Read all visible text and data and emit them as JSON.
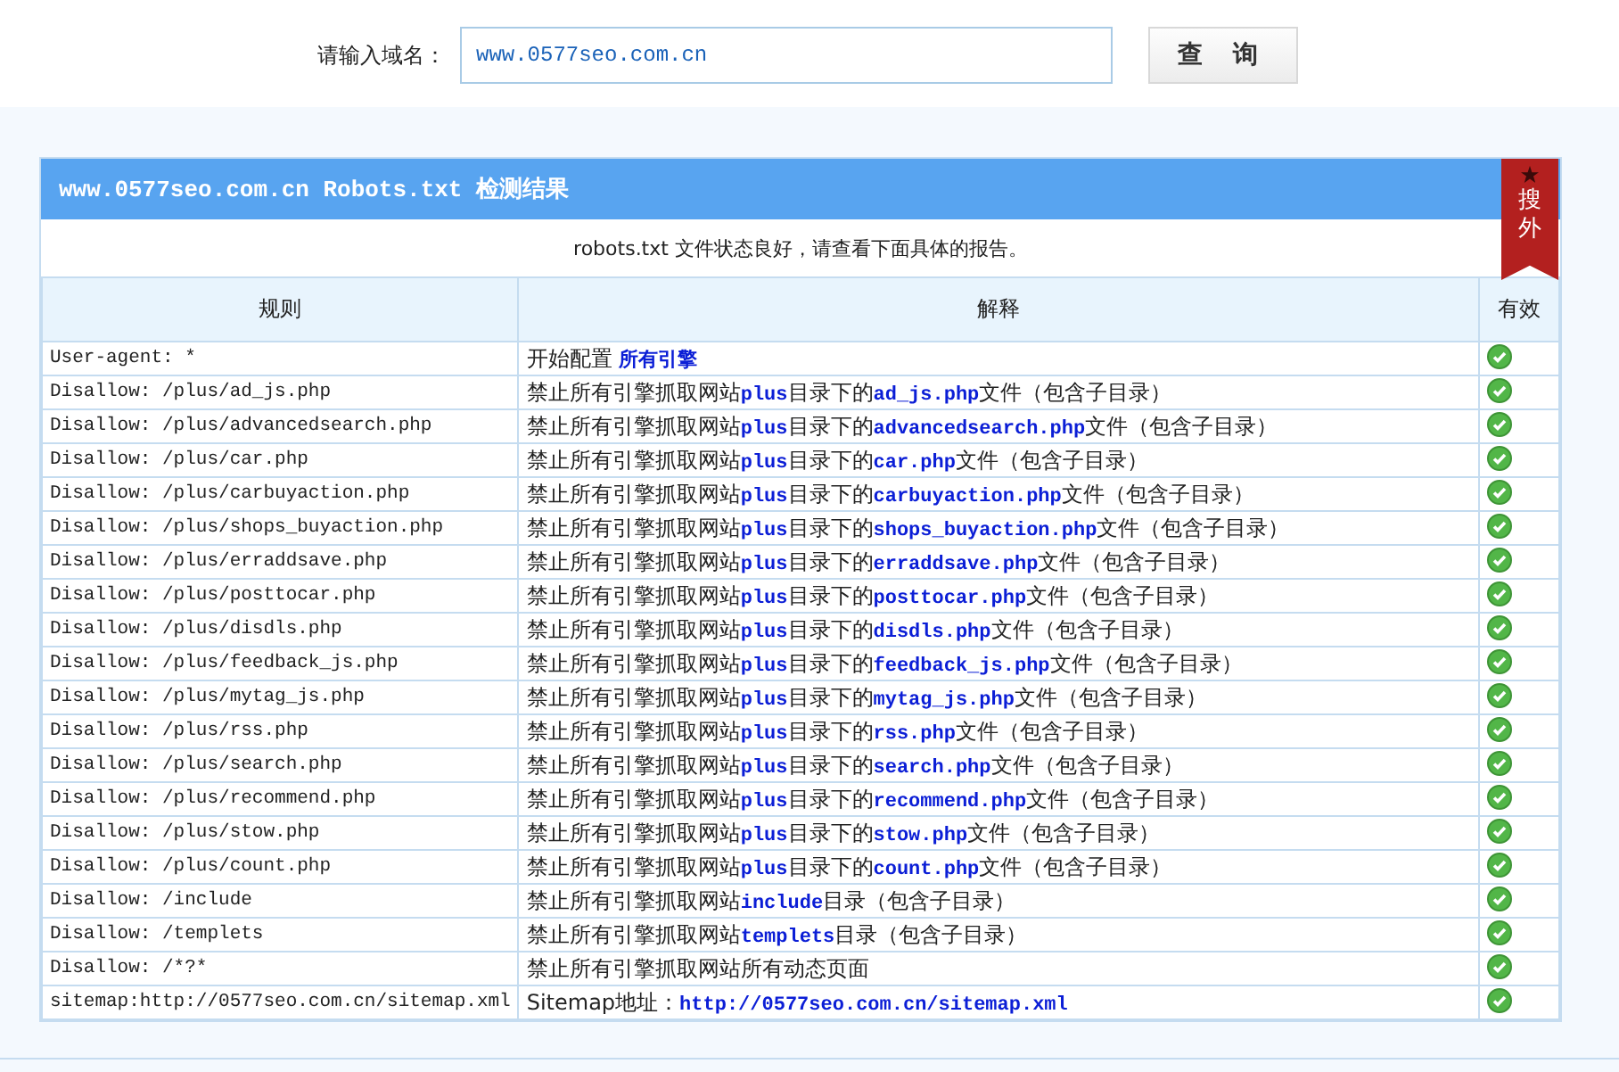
{
  "search": {
    "label": "请输入域名：",
    "value": "www.0577seo.com.cn",
    "button": "查 询"
  },
  "result": {
    "title": "www.0577seo.com.cn Robots.txt 检测结果",
    "ribbon": "搜外",
    "summary": "robots.txt 文件状态良好，请查看下面具体的报告。"
  },
  "table": {
    "columns": [
      "规则",
      "解释",
      "有效"
    ],
    "rows": [
      {
        "rule": "User-agent: *",
        "explanation": "开始配置 **所有引擎**",
        "valid": true
      },
      {
        "rule": "Disallow: /plus/ad_js.php",
        "explanation": "禁止所有引擎抓取网站**plus**目录下的**ad_js.php**文件（包含子目录）",
        "valid": true
      },
      {
        "rule": "Disallow: /plus/advancedsearch.php",
        "explanation": "禁止所有引擎抓取网站**plus**目录下的**advancedsearch.php**文件（包含子目录）",
        "valid": true
      },
      {
        "rule": "Disallow: /plus/car.php",
        "explanation": "禁止所有引擎抓取网站**plus**目录下的**car.php**文件（包含子目录）",
        "valid": true
      },
      {
        "rule": "Disallow: /plus/carbuyaction.php",
        "explanation": "禁止所有引擎抓取网站**plus**目录下的**carbuyaction.php**文件（包含子目录）",
        "valid": true
      },
      {
        "rule": "Disallow: /plus/shops_buyaction.php",
        "explanation": "禁止所有引擎抓取网站**plus**目录下的**shops_buyaction.php**文件（包含子目录）",
        "valid": true
      },
      {
        "rule": "Disallow: /plus/erraddsave.php",
        "explanation": "禁止所有引擎抓取网站**plus**目录下的**erraddsave.php**文件（包含子目录）",
        "valid": true
      },
      {
        "rule": "Disallow: /plus/posttocar.php",
        "explanation": "禁止所有引擎抓取网站**plus**目录下的**posttocar.php**文件（包含子目录）",
        "valid": true
      },
      {
        "rule": "Disallow: /plus/disdls.php",
        "explanation": "禁止所有引擎抓取网站**plus**目录下的**disdls.php**文件（包含子目录）",
        "valid": true
      },
      {
        "rule": "Disallow: /plus/feedback_js.php",
        "explanation": "禁止所有引擎抓取网站**plus**目录下的**feedback_js.php**文件（包含子目录）",
        "valid": true
      },
      {
        "rule": "Disallow: /plus/mytag_js.php",
        "explanation": "禁止所有引擎抓取网站**plus**目录下的**mytag_js.php**文件（包含子目录）",
        "valid": true
      },
      {
        "rule": "Disallow: /plus/rss.php",
        "explanation": "禁止所有引擎抓取网站**plus**目录下的**rss.php**文件（包含子目录）",
        "valid": true
      },
      {
        "rule": "Disallow: /plus/search.php",
        "explanation": "禁止所有引擎抓取网站**plus**目录下的**search.php**文件（包含子目录）",
        "valid": true
      },
      {
        "rule": "Disallow: /plus/recommend.php",
        "explanation": "禁止所有引擎抓取网站**plus**目录下的**recommend.php**文件（包含子目录）",
        "valid": true
      },
      {
        "rule": "Disallow: /plus/stow.php",
        "explanation": "禁止所有引擎抓取网站**plus**目录下的**stow.php**文件（包含子目录）",
        "valid": true
      },
      {
        "rule": "Disallow: /plus/count.php",
        "explanation": "禁止所有引擎抓取网站**plus**目录下的**count.php**文件（包含子目录）",
        "valid": true
      },
      {
        "rule": "Disallow: /include",
        "explanation": "禁止所有引擎抓取网站**include**目录（包含子目录）",
        "valid": true
      },
      {
        "rule": "Disallow: /templets",
        "explanation": "禁止所有引擎抓取网站**templets**目录（包含子目录）",
        "valid": true
      },
      {
        "rule": "Disallow: /*?*",
        "explanation": "禁止所有引擎抓取网站所有动态页面",
        "valid": true
      },
      {
        "rule": "sitemap:http://0577seo.com.cn/sitemap.xml",
        "explanation": "Sitemap地址：**http://0577seo.com.cn/sitemap.xml**",
        "valid": true
      }
    ]
  }
}
